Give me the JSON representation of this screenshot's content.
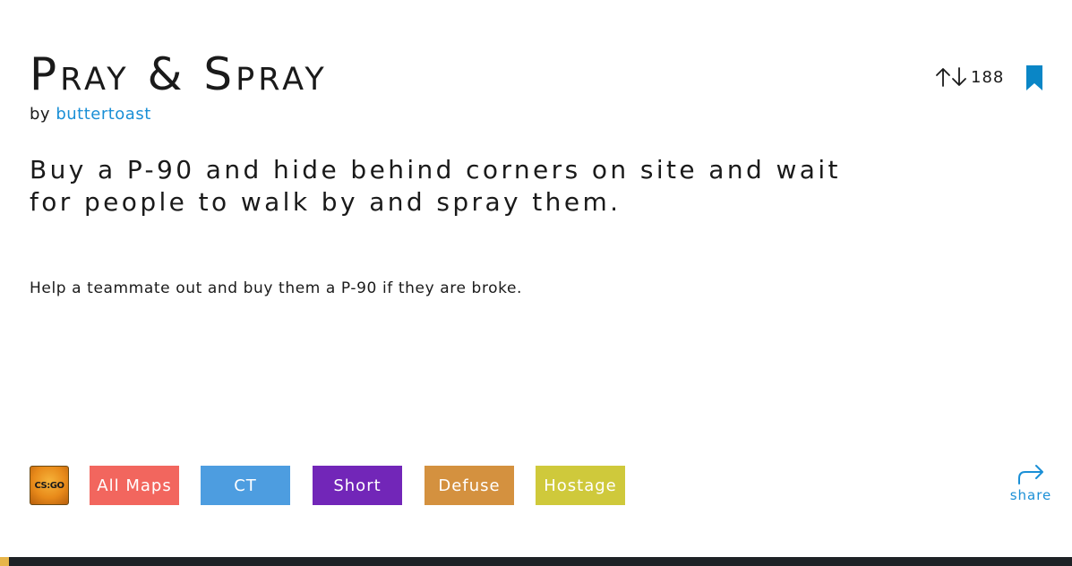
{
  "post": {
    "title": "Pray & Spray",
    "by_label": "by",
    "author": "buttertoast",
    "description": "Buy a P-90 and hide behind corners on site and wait for people to walk by and spray them.",
    "tip": "Help a teammate out and buy them a P-90 if they are broke."
  },
  "votes": {
    "count": "188",
    "upvote_icon": "arrow-up-icon",
    "downvote_icon": "arrow-down-icon"
  },
  "bookmark": {
    "icon": "bookmark-icon",
    "color": "#0a86c6"
  },
  "game": {
    "icon_label": "CS:GO",
    "icon": "csgo-icon"
  },
  "tags": [
    {
      "label": "All Maps",
      "color": "#f2665e"
    },
    {
      "label": "CT",
      "color": "#4d9de0"
    },
    {
      "label": "Short",
      "color": "#7226b8"
    },
    {
      "label": "Defuse",
      "color": "#d4913f"
    },
    {
      "label": "Hostage",
      "color": "#cfc93b"
    }
  ],
  "share": {
    "label": "share",
    "icon": "share-arrow-icon",
    "color": "#1a8fd6"
  }
}
